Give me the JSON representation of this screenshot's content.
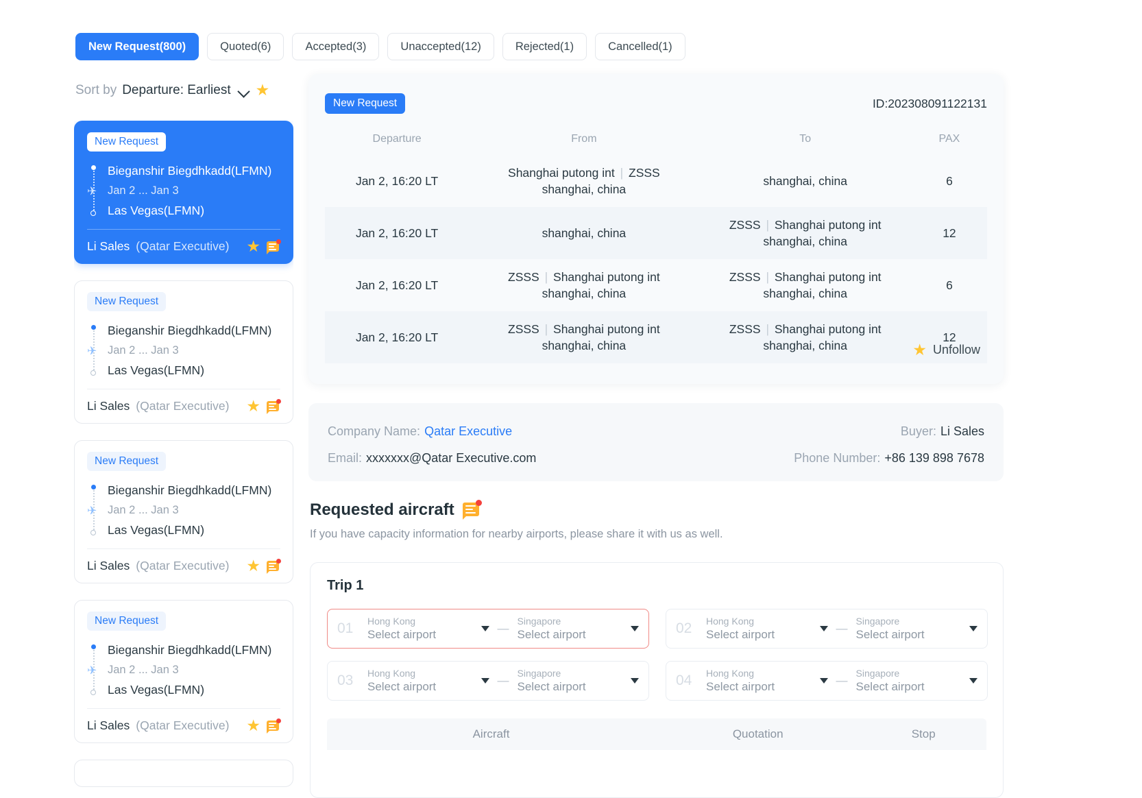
{
  "tabs": [
    {
      "label": "New Request(800)",
      "active": true
    },
    {
      "label": "Quoted(6)",
      "active": false
    },
    {
      "label": "Accepted(3)",
      "active": false
    },
    {
      "label": "Unaccepted(12)",
      "active": false
    },
    {
      "label": "Rejected(1)",
      "active": false
    },
    {
      "label": "Cancelled(1)",
      "active": false
    }
  ],
  "sort": {
    "prefix": "Sort by",
    "value": "Departure: Earliest",
    "star_icon": "★"
  },
  "request_cards": [
    {
      "status": "New Request",
      "from": "Bieganshir Biegdhkadd(LFMN)",
      "dates": "Jan 2 ... Jan 3",
      "to": "Las Vegas(LFMN)",
      "buyer": "Li Sales",
      "company": "(Qatar Executive)",
      "selected": true
    },
    {
      "status": "New Request",
      "from": "Bieganshir Biegdhkadd(LFMN)",
      "dates": "Jan 2 ... Jan 3",
      "to": "Las Vegas(LFMN)",
      "buyer": "Li Sales",
      "company": "(Qatar Executive)",
      "selected": false
    },
    {
      "status": "New Request",
      "from": "Bieganshir Biegdhkadd(LFMN)",
      "dates": "Jan 2 ... Jan 3",
      "to": "Las Vegas(LFMN)",
      "buyer": "Li Sales",
      "company": "(Qatar Executive)",
      "selected": false
    },
    {
      "status": "New Request",
      "from": "Bieganshir Biegdhkadd(LFMN)",
      "dates": "Jan 2 ... Jan 3",
      "to": "Las Vegas(LFMN)",
      "buyer": "Li Sales",
      "company": "(Qatar Executive)",
      "selected": false
    }
  ],
  "detail": {
    "status_pill": "New Request",
    "id": "ID:202308091122131",
    "columns": [
      "Departure",
      "From",
      "To",
      "PAX"
    ],
    "rows": [
      {
        "departure": "Jan 2, 16:20 LT",
        "from_code": "Shanghai putong int",
        "from_sep": "|",
        "from_icao": "ZSSS",
        "from_city": "shanghai, china",
        "from_plain": "",
        "to_code": "",
        "to_icao": "",
        "to_city": "shanghai, china",
        "to_plain": "shanghai, china",
        "pax": "6"
      },
      {
        "departure": "Jan 2, 16:20 LT",
        "from_plain": "shanghai, china",
        "to_icao": "ZSSS",
        "to_code": "Shanghai putong int",
        "to_city": "shanghai, china",
        "pax": "12"
      },
      {
        "departure": "Jan 2, 16:20 LT",
        "from_icao": "ZSSS",
        "from_code": "Shanghai putong int",
        "from_city": "shanghai, china",
        "to_icao": "ZSSS",
        "to_code": "Shanghai putong int",
        "to_city": "shanghai, china",
        "pax": "6"
      },
      {
        "departure": "Jan 2, 16:20 LT",
        "from_icao": "ZSSS",
        "from_code": "Shanghai putong int",
        "from_city": "shanghai, china",
        "to_icao": "ZSSS",
        "to_code": "Shanghai putong int",
        "to_city": "shanghai, china",
        "pax": "12"
      }
    ],
    "unfollow_label": "Unfollow"
  },
  "company": {
    "name_label": "Company Name:",
    "name_value": "Qatar Executive",
    "buyer_label": "Buyer:",
    "buyer_value": "Li Sales",
    "email_label": "Email:",
    "email_value": "xxxxxxx@Qatar Executive.com",
    "phone_label": "Phone Number:",
    "phone_value": "+86 139 898 7678"
  },
  "requested_aircraft": {
    "title": "Requested aircraft",
    "subtitle": "If you have capacity information for nearby airports, please share it with us as well."
  },
  "trip": {
    "title": "Trip 1",
    "legs": [
      {
        "num": "01",
        "origin_hint": "Hong Kong",
        "origin_value": "Select airport",
        "dest_hint": "Singapore",
        "dest_value": "Select airport",
        "invalid": true
      },
      {
        "num": "02",
        "origin_hint": "Hong Kong",
        "origin_value": "Select airport",
        "dest_hint": "Singapore",
        "dest_value": "Select airport",
        "invalid": false
      },
      {
        "num": "03",
        "origin_hint": "Hong Kong",
        "origin_value": "Select airport",
        "dest_hint": "Singapore",
        "dest_value": "Select airport",
        "invalid": false
      },
      {
        "num": "04",
        "origin_hint": "Hong Kong",
        "origin_value": "Select airport",
        "dest_hint": "Singapore",
        "dest_value": "Select airport",
        "invalid": false
      }
    ],
    "dash": "—",
    "sub_columns": [
      "Aircraft",
      "Quotation",
      "Stop"
    ]
  },
  "colors": {
    "accent": "#2a7cf7",
    "star": "#ffc533",
    "chat": "#ffb02e",
    "alert": "#f4413c",
    "invalid_border": "#f08a86"
  }
}
